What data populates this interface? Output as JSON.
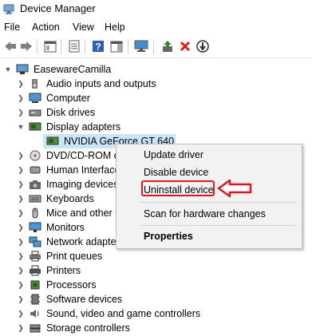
{
  "window": {
    "title": "Device Manager",
    "icon": "device-manager-icon"
  },
  "menu": [
    "File",
    "Action",
    "View",
    "Help"
  ],
  "toolbar": {
    "buttons": [
      "back-icon",
      "forward-icon",
      "show-hide-tree-icon",
      "properties-icon",
      "help-icon",
      "action-pane-icon",
      "monitor-scan-icon",
      "update-driver-icon",
      "uninstall-icon",
      "disable-icon"
    ],
    "uninstall_color": "#d81e1e",
    "update_color": "#2f8a2f"
  },
  "tree": {
    "root": "EasewareCamilla",
    "items": [
      {
        "label": "Audio inputs and outputs",
        "icon": "speaker-icon",
        "expanded": false
      },
      {
        "label": "Computer",
        "icon": "computer-icon",
        "expanded": false
      },
      {
        "label": "Disk drives",
        "icon": "disk-icon",
        "expanded": false
      },
      {
        "label": "Display adapters",
        "icon": "display-adapter-icon",
        "expanded": true,
        "children": [
          {
            "label": "NVIDIA GeForce GT 640",
            "icon": "gpu-icon",
            "selected": true
          }
        ]
      },
      {
        "label": "DVD/CD-ROM d",
        "icon": "dvd-icon",
        "expanded": false
      },
      {
        "label": "Human Interface",
        "icon": "hid-icon",
        "expanded": false
      },
      {
        "label": "Imaging devices",
        "icon": "camera-icon",
        "expanded": false
      },
      {
        "label": "Keyboards",
        "icon": "keyboard-icon",
        "expanded": false
      },
      {
        "label": "Mice and other p",
        "icon": "mouse-icon",
        "expanded": false
      },
      {
        "label": "Monitors",
        "icon": "monitor-icon",
        "expanded": false
      },
      {
        "label": "Network adapte",
        "icon": "network-icon",
        "expanded": false
      },
      {
        "label": "Print queues",
        "icon": "print-queue-icon",
        "expanded": false
      },
      {
        "label": "Printers",
        "icon": "printer-icon",
        "expanded": false
      },
      {
        "label": "Processors",
        "icon": "processor-icon",
        "expanded": false
      },
      {
        "label": "Software devices",
        "icon": "software-device-icon",
        "expanded": false
      },
      {
        "label": "Sound, video and game controllers",
        "icon": "sound-icon",
        "expanded": false
      },
      {
        "label": "Storage controllers",
        "icon": "storage-icon",
        "expanded": false
      }
    ]
  },
  "context_menu": {
    "items": [
      "Update driver",
      "Disable device",
      "Uninstall device",
      "Scan for hardware changes",
      "Properties"
    ],
    "highlight_color": "#e0141c"
  }
}
